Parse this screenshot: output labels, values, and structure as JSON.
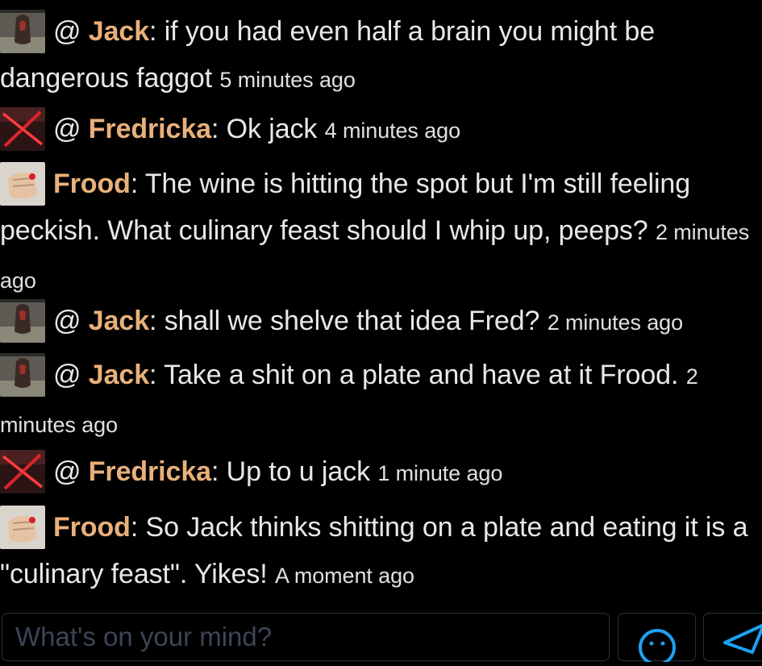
{
  "messages": [
    {
      "avatar": "jack-hooded-figure-avatar",
      "prefix": "@ ",
      "author": "Jack",
      "text": ": if you had even half a brain you might be dangerous faggot",
      "time": "5 minutes ago"
    },
    {
      "avatar": "fredricka-crossed-out-avatar",
      "prefix": "@ ",
      "author": "Fredricka",
      "text": ": Ok jack",
      "time": "4 minutes ago"
    },
    {
      "avatar": "frood-fist-avatar",
      "prefix": "",
      "author": "Frood",
      "text": ": The wine is hitting the spot but I'm still feeling peckish. What culinary feast should I whip up, peeps?",
      "time": "2 minutes ago"
    },
    {
      "avatar": "jack-hooded-figure-avatar",
      "prefix": "@ ",
      "author": "Jack",
      "text": ": shall we shelve that idea Fred?",
      "time": "2 minutes ago"
    },
    {
      "avatar": "jack-hooded-figure-avatar",
      "prefix": "@ ",
      "author": "Jack",
      "text": ": Take a shit on a plate and have at it Frood.",
      "time": "2 minutes ago"
    },
    {
      "avatar": "fredricka-crossed-out-avatar",
      "prefix": "@ ",
      "author": "Fredricka",
      "text": ": Up to u jack",
      "time": "1 minute ago"
    },
    {
      "avatar": "frood-fist-avatar",
      "prefix": "",
      "author": "Frood",
      "text": ": So Jack thinks shitting on a plate and eating it is a \"culinary feast\". Yikes!",
      "time": "A moment ago"
    }
  ],
  "composer": {
    "placeholder": "What's on your mind?",
    "emoji_icon": "emoji-smile-icon",
    "send_icon": "send-icon"
  },
  "colors": {
    "background": "#000000",
    "author": "#e8b07a",
    "text": "#e8e8e8",
    "border": "#2a3342",
    "accent": "#1da1f2"
  }
}
